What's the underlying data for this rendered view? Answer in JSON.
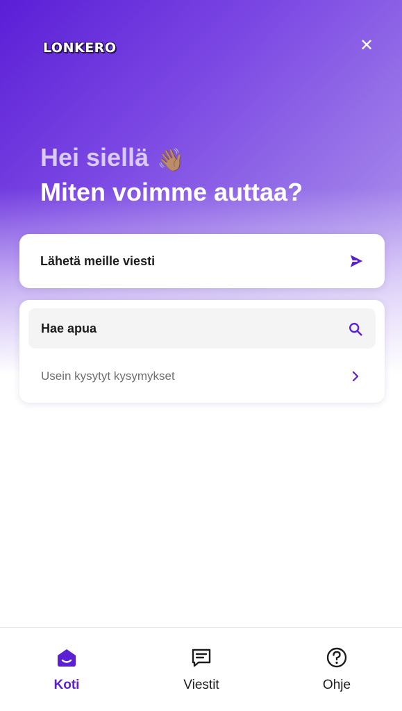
{
  "header": {
    "logo_text": "LONKERO",
    "close_symbol": "✕"
  },
  "hero": {
    "greeting": "Hei siellä",
    "wave_emoji": "👋🏽",
    "headline": "Miten voimme auttaa?"
  },
  "cards": {
    "send_message_label": "Lähetä meille viesti",
    "search_help_label": "Hae apua",
    "faq_label": "Usein kysytyt kysymykset"
  },
  "nav": {
    "items": [
      {
        "label": "Koti",
        "icon": "home-icon"
      },
      {
        "label": "Viestit",
        "icon": "messages-icon"
      },
      {
        "label": "Ohje",
        "icon": "help-icon"
      }
    ]
  },
  "colors": {
    "accent": "#5b1fd4",
    "hero_start": "#5a1ed6",
    "hero_end": "#c1a9f2"
  }
}
